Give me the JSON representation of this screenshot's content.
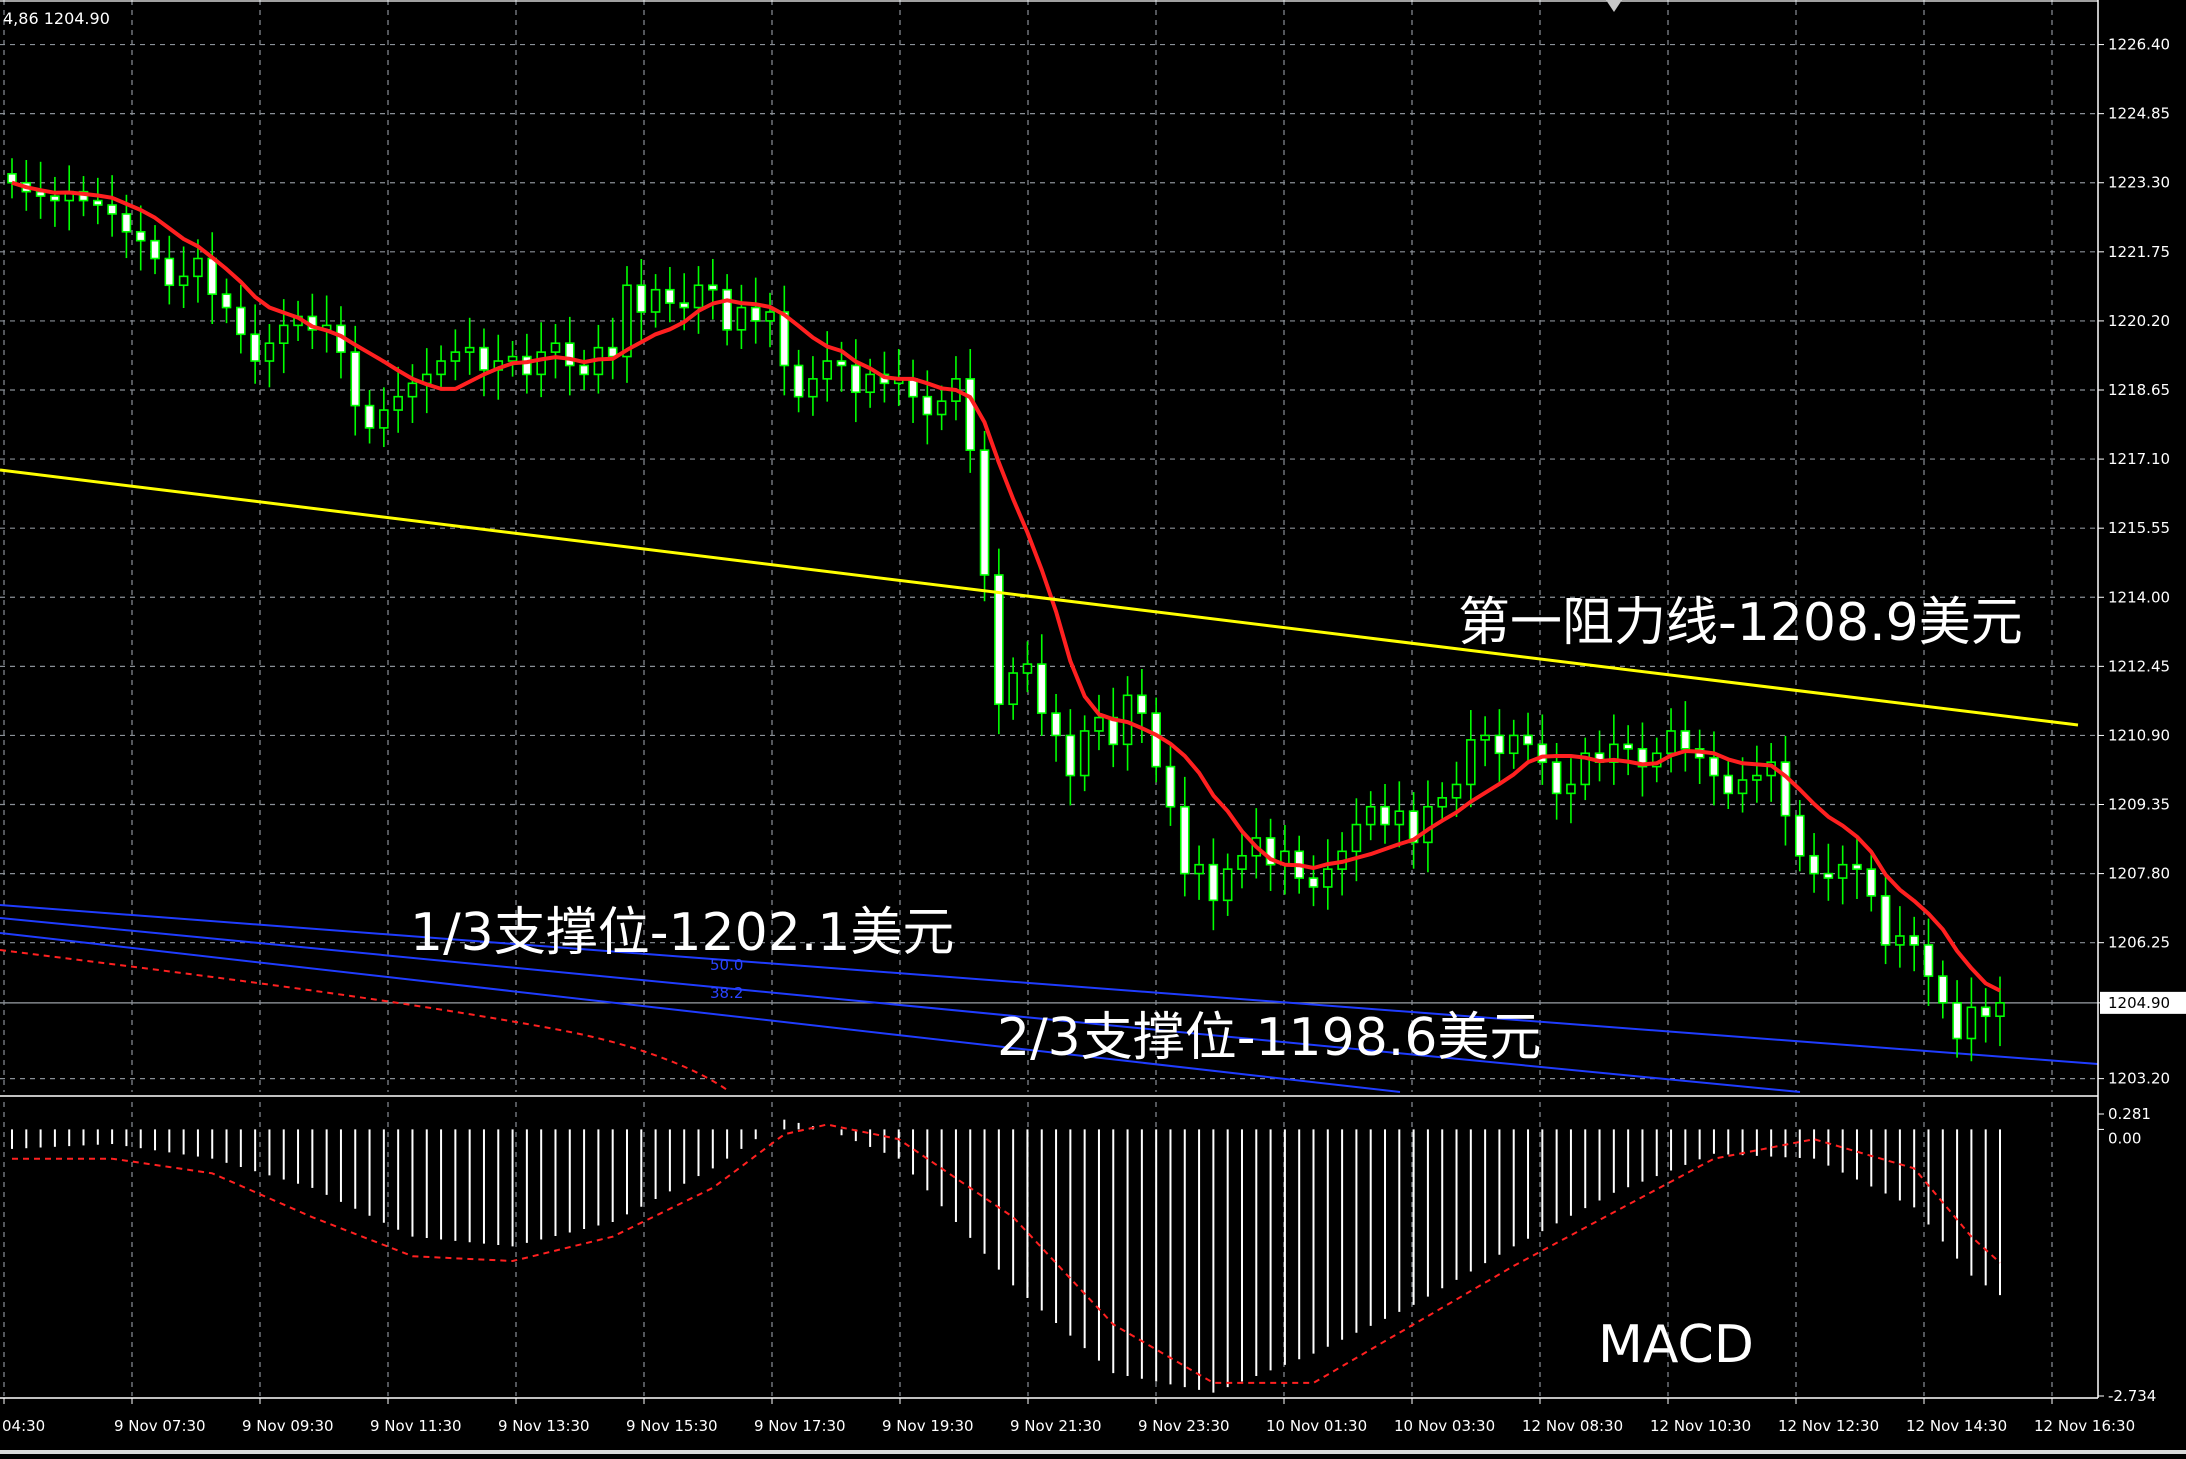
{
  "header": {
    "info": "4,86 1204.90"
  },
  "annotations": {
    "resistance": "第一阻力线-1208.9美元",
    "support_1_3": "1/3支撑位-1202.1美元",
    "support_2_3": "2/3支撑位-1198.6美元",
    "macd_label": "MACD",
    "fib_50": "50.0",
    "fib_38": "38.2"
  },
  "colors": {
    "background": "#000000",
    "grid": "#8a9097",
    "bull": "#00ff00",
    "bear": "#ffffff",
    "ma": "#ff2020",
    "trendline": "#ffff00",
    "channel": "#1f3cff",
    "macd_hist": "#ffffff",
    "macd_signal": "#ff2020"
  },
  "chart_data": [
    {
      "type": "candlestick",
      "price_ticks": [
        "1226.40",
        "1224.85",
        "1223.30",
        "1221.75",
        "1220.20",
        "1218.65",
        "1217.10",
        "1215.55",
        "1214.00",
        "1212.45",
        "1210.90",
        "1209.35",
        "1207.80",
        "1206.25",
        "1204.90",
        "1203.20"
      ],
      "current_price": "1204.90",
      "ylim": [
        1202.9,
        1227.4
      ],
      "time_ticks": [
        "04:30",
        "9 Nov 07:30",
        "9 Nov 09:30",
        "9 Nov 11:30",
        "9 Nov 13:30",
        "9 Nov 15:30",
        "9 Nov 17:30",
        "9 Nov 19:30",
        "9 Nov 21:30",
        "9 Nov 23:30",
        "10 Nov 01:30",
        "10 Nov 03:30",
        "12 Nov 08:30",
        "12 Nov 10:30",
        "12 Nov 12:30",
        "12 Nov 14:30",
        "12 Nov 16:30"
      ],
      "candles_close": [
        1223.3,
        1223.1,
        1223.0,
        1222.9,
        1223.1,
        1222.9,
        1222.8,
        1222.6,
        1222.2,
        1222.0,
        1221.6,
        1221.0,
        1221.2,
        1221.6,
        1220.8,
        1220.5,
        1219.9,
        1219.3,
        1219.7,
        1220.1,
        1220.3,
        1220.0,
        1220.1,
        1219.5,
        1218.3,
        1217.8,
        1218.2,
        1218.5,
        1218.8,
        1219.0,
        1219.3,
        1219.5,
        1219.6,
        1219.1,
        1219.3,
        1219.4,
        1219.0,
        1219.5,
        1219.7,
        1219.2,
        1219.0,
        1219.6,
        1219.4,
        1221.0,
        1220.4,
        1220.9,
        1220.6,
        1220.5,
        1221.0,
        1220.9,
        1220.0,
        1220.5,
        1220.2,
        1220.4,
        1219.2,
        1218.5,
        1218.9,
        1219.3,
        1219.2,
        1218.6,
        1219.0,
        1218.8,
        1218.9,
        1218.5,
        1218.1,
        1218.4,
        1218.9,
        1217.3,
        1214.5,
        1211.6,
        1212.3,
        1212.5,
        1211.4,
        1210.9,
        1210.0,
        1211.0,
        1211.3,
        1210.7,
        1211.8,
        1211.4,
        1210.2,
        1209.3,
        1207.8,
        1208.0,
        1207.2,
        1207.9,
        1208.2,
        1208.6,
        1208.0,
        1208.3,
        1207.7,
        1207.5,
        1207.9,
        1208.3,
        1208.9,
        1209.3,
        1208.9,
        1209.2,
        1208.5,
        1209.3,
        1209.5,
        1209.8,
        1210.8,
        1210.9,
        1210.5,
        1210.9,
        1210.7,
        1210.3,
        1209.6,
        1209.8,
        1210.5,
        1210.3,
        1210.7,
        1210.6,
        1210.2,
        1210.5,
        1211.0,
        1210.6,
        1210.4,
        1210.0,
        1209.6,
        1209.9,
        1210.0,
        1210.3,
        1209.1,
        1208.2,
        1207.8,
        1207.7,
        1208.0,
        1207.9,
        1207.3,
        1206.2,
        1206.4,
        1206.2,
        1205.5,
        1204.9,
        1204.1,
        1204.8,
        1204.6,
        1204.9
      ]
    },
    {
      "type": "bar",
      "name": "MACD",
      "ticks": [
        "0.281",
        "0.00",
        "-2.734"
      ],
      "ylim": [
        -2.734,
        0.281
      ],
      "x_samples": [
        0,
        7,
        14,
        21,
        28,
        35,
        42,
        49,
        54,
        57,
        62,
        70,
        77,
        84,
        91,
        98,
        105,
        112,
        119,
        126,
        133,
        137,
        140
      ],
      "hist": [
        -0.2,
        -0.15,
        -0.3,
        -0.6,
        -1.1,
        -1.2,
        -0.95,
        -0.4,
        0.1,
        0.0,
        -0.3,
        -1.6,
        -2.5,
        -2.7,
        -2.3,
        -1.8,
        -1.2,
        -0.65,
        -0.25,
        -0.3,
        -0.8,
        -1.5,
        -1.8
      ],
      "signal": [
        -0.3,
        -0.3,
        -0.45,
        -0.9,
        -1.3,
        -1.35,
        -1.1,
        -0.6,
        -0.05,
        0.05,
        -0.1,
        -0.9,
        -2.0,
        -2.6,
        -2.6,
        -2.0,
        -1.4,
        -0.85,
        -0.3,
        -0.1,
        -0.4,
        -1.1,
        -1.5
      ]
    }
  ]
}
